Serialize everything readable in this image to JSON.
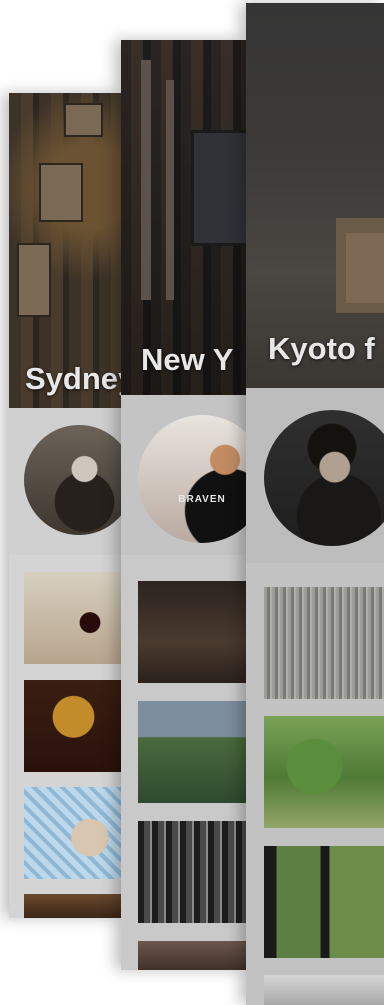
{
  "cards": [
    {
      "title": "Sydney"
    },
    {
      "title": "New Y"
    },
    {
      "title": "Kyoto f"
    }
  ],
  "avatar_text": {
    "new_york_shirt": "BRAVEN"
  }
}
